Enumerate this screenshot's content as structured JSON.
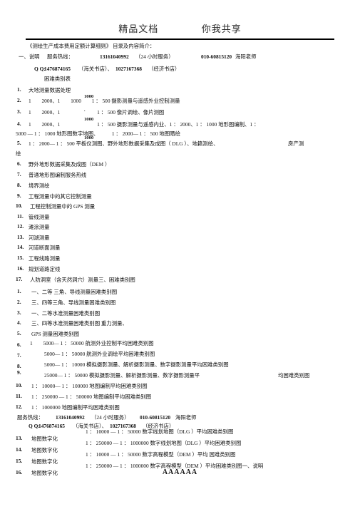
{
  "header": {
    "left_text": "精品文档",
    "right_text": "你我共享"
  },
  "footer": {
    "text": "AAAAAA"
  },
  "intro": {
    "title_line": "《测绘生产成本费用定额计算细则》  目录及内容简介：",
    "section_marker": "一、说明",
    "hotline_label": "服务热线：",
    "hotline_mobile": "13161040992",
    "hotline_mobile_note": "（24 小时服务）",
    "hotline_landline": "010-60815120",
    "hotline_person": "海阳老师",
    "qq_label": "Q Q:",
    "qq_1": "1476874165",
    "qq_1_note": "（海关书店）、",
    "qq_2": "1027167368",
    "qq_2_note": "（经济书店）",
    "catalog_heading": "困难类别表"
  },
  "list_one": [
    {
      "n": "1.",
      "text": "大地测量数据处理"
    },
    {
      "n": "2.",
      "text": "1　　2000、1　　1000　　1 ： 500 摄影测量与遥感外业控制测量"
    },
    {
      "n": "3.",
      "text": "1　　2000、1　　　　　　　1 ： 500 像片调绘、像片测图"
    },
    {
      "n": "4.",
      "text": "1　　2000、1　　　　　　　1 ： 500 摄影测量与遥感内业、1 ： 2000、1 ： 1000 地形图编制、1 ："
    },
    {
      "n": "",
      "text": "5000 — 1 ： 1000 地形图数字地图、　　　1 ： 2000— 1 ： 500 地图晒绘"
    },
    {
      "n": "5.",
      "text": "1 ： 2000— 1 ： 500 平板仪测图、野外地形数据采集及成图（ DLG ）、地籍测绘、"
    },
    {
      "n": "",
      "text": "绘"
    },
    {
      "n": "6.",
      "text": "野外地形数据采集及成图（DEM ）"
    },
    {
      "n": "7.",
      "text": "普通地形图编制服务热线"
    },
    {
      "n": "8.",
      "text": "境界测绘"
    },
    {
      "n": "9.",
      "text": "工程测量中的其它控制测量"
    },
    {
      "n": "10.",
      "text": "工程控制测量中的 GPS 测量"
    },
    {
      "n": "11.",
      "text": "管线测量"
    },
    {
      "n": "12.",
      "text": "滩涂测量"
    },
    {
      "n": "13.",
      "text": "河湖测量"
    },
    {
      "n": "14.",
      "text": "河道断面测量"
    },
    {
      "n": "15.",
      "text": "工程线路测量"
    },
    {
      "n": "16.",
      "text": "规划道路定线"
    },
    {
      "n": "17.",
      "text": "人防洞室（含天然洞穴）测量三、困难类别图"
    }
  ],
  "list_one_right_note": "房产测",
  "list_two": [
    {
      "n": "1.",
      "text": "一、二等 三角、导线测量困难类别图"
    },
    {
      "n": "2.",
      "text": "三、四等三角、导线测量困难类别图"
    },
    {
      "n": "3.",
      "text": "一、二等水准测量困难类别图"
    },
    {
      "n": "4.",
      "text": "三、四等水准测量困难类别图 重力测量、"
    },
    {
      "n": "5.",
      "text": "GPS 测量困难类别图"
    },
    {
      "n": "6.",
      "text": "1　　5000— 1 ： 50000 航测外业控制平均困难类别图"
    },
    {
      "n": "7.",
      "text": "5000— 1 ： 50000 航测外业调绘平均困难类别图"
    },
    {
      "n": "8.",
      "text": "5000— 1 ： 10000 模拟摄影测量、解析摄影测量、数字摄影测量平均困难类别图"
    },
    {
      "n": "9.",
      "text": "25000— 1 ： 50000 模拟摄影测量、解析摄影测量、数字摄影测量平"
    },
    {
      "n": "10.",
      "text": "1 ： 10000— 1 ： 100000 地图编制平均困难类别图"
    },
    {
      "n": "11.",
      "text": "1 ： 250000 — 1 ： 500000 地图编制平均困难类别图"
    },
    {
      "n": "12.",
      "text": "1 ： 1000000 地图编制平均困难类别图"
    }
  ],
  "list_two_item9_right": "均困难类别图",
  "hotline_repeat": {
    "label": "服务热线：",
    "mobile": "13161040992",
    "mobile_note": "（24 小时服务）",
    "landline": "010-60815120",
    "person": "海阳老师"
  },
  "qq_repeat": {
    "label": "Q Q:",
    "qq_1": "1476874165",
    "qq_1_note": "（海关书店）、",
    "qq_2": "1027167368",
    "qq_2_note": "（经济书店）"
  },
  "list_three": [
    {
      "n": "13.",
      "label": "地图数字化",
      "detail": "1 ：  10000 — 1 ： 50000 数字线划地图（DLG ）平均困难类别图"
    },
    {
      "n": "14.",
      "label": "地图数字化",
      "detail": "1 ： 250000 — 1 ： 1000000 数字线划地图（DLG ）平均困难类别图"
    },
    {
      "n": "15.",
      "label": "地图数字化",
      "detail": "1 ： 10000 — 1 ： 50000 数字高程模型（DEM ）平均 困难类别图"
    },
    {
      "n": "16.",
      "label": "地图数字化",
      "detail": "1 ： 250000 — 1 ： 1000000 数字高程模型（DEM ）平均困难类别图一、说明"
    }
  ],
  "stray_fragments": [
    {
      "text": "1000"
    },
    {
      "text": "."
    },
    {
      "text": "1000"
    },
    {
      "text": "1000"
    },
    {
      "text": "."
    }
  ]
}
